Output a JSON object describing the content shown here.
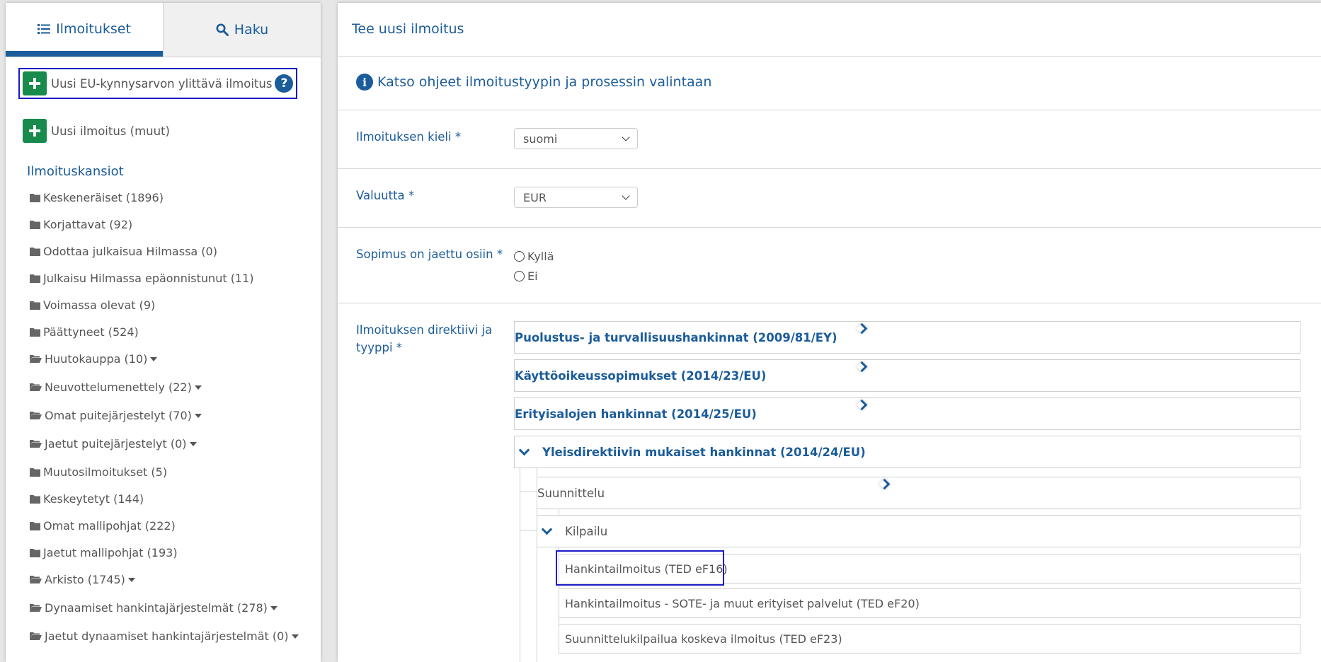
{
  "left_tabs": [
    {
      "label": "Ilmoitukset",
      "icon": "list-icon",
      "active": true
    },
    {
      "label": "Haku",
      "icon": "search-icon",
      "active": false
    }
  ],
  "new_buttons": {
    "eu": "Uusi EU-kynnysarvon ylittävä ilmoitus",
    "help": "?",
    "other": "Uusi ilmoitus (muut)"
  },
  "folders_title": "Ilmoituskansiot",
  "folders": [
    {
      "label": "Keskeneräiset (1896)",
      "open": false,
      "dropdown": false
    },
    {
      "label": "Korjattavat (92)",
      "open": false,
      "dropdown": false
    },
    {
      "label": "Odottaa julkaisua Hilmassa (0)",
      "open": false,
      "dropdown": false
    },
    {
      "label": "Julkaisu Hilmassa epäonnistunut (11)",
      "open": false,
      "dropdown": false
    },
    {
      "label": "Voimassa olevat (9)",
      "open": false,
      "dropdown": false
    },
    {
      "label": "Päättyneet (524)",
      "open": false,
      "dropdown": false
    },
    {
      "label": "Huutokauppa (10)",
      "open": true,
      "dropdown": true
    },
    {
      "label": "Neuvottelumenettely (22)",
      "open": true,
      "dropdown": true
    },
    {
      "label": "Omat puitejärjestelyt (70)",
      "open": true,
      "dropdown": true
    },
    {
      "label": "Jaetut puitejärjestelyt (0)",
      "open": true,
      "dropdown": true
    },
    {
      "label": "Muutosilmoitukset (5)",
      "open": false,
      "dropdown": false
    },
    {
      "label": "Keskeytetyt (144)",
      "open": false,
      "dropdown": false
    },
    {
      "label": "Omat mallipohjat (222)",
      "open": false,
      "dropdown": false
    },
    {
      "label": "Jaetut mallipohjat (193)",
      "open": false,
      "dropdown": false
    },
    {
      "label": "Arkisto (1745)",
      "open": true,
      "dropdown": true
    },
    {
      "label": "Dynaamiset hankintajärjestelmät (278)",
      "open": true,
      "dropdown": true
    },
    {
      "label": "Jaetut dynaamiset hankintajärjestelmät (0)",
      "open": true,
      "dropdown": true
    }
  ],
  "main": {
    "title": "Tee uusi ilmoitus",
    "info_link": "Katso ohjeet ilmoitustyypin ja prosessin valintaan",
    "language_label": "Ilmoituksen kieli *",
    "language_value": "suomi",
    "currency_label": "Valuutta *",
    "currency_value": "EUR",
    "split_label": "Sopimus on jaettu osiin *",
    "split_yes": "Kyllä",
    "split_no": "Ei",
    "directive_label_1": "Ilmoituksen direktiivi ja",
    "directive_label_2": "tyyppi *",
    "directives": [
      "Puolustus- ja turvallisuushankinnat (2009/81/EY)",
      "Käyttöoikeussopimukset (2014/23/EU)",
      "Erityisalojen hankinnat (2014/25/EU)",
      "Yleisdirektiivin mukaiset hankinnat (2014/24/EU)"
    ],
    "phases": [
      "Suunnittelu",
      "Kilpailu"
    ],
    "notices": [
      "Hankintailmoitus (TED eF16)",
      "Hankintailmoitus - SOTE- ja muut erityiset palvelut (TED eF20)",
      "Suunnittelukilpailua koskeva ilmoitus (TED eF23)"
    ]
  },
  "colors": {
    "brand": "#1b5c9a",
    "plus": "#178a4c",
    "highlight": "#1a1ac8"
  }
}
